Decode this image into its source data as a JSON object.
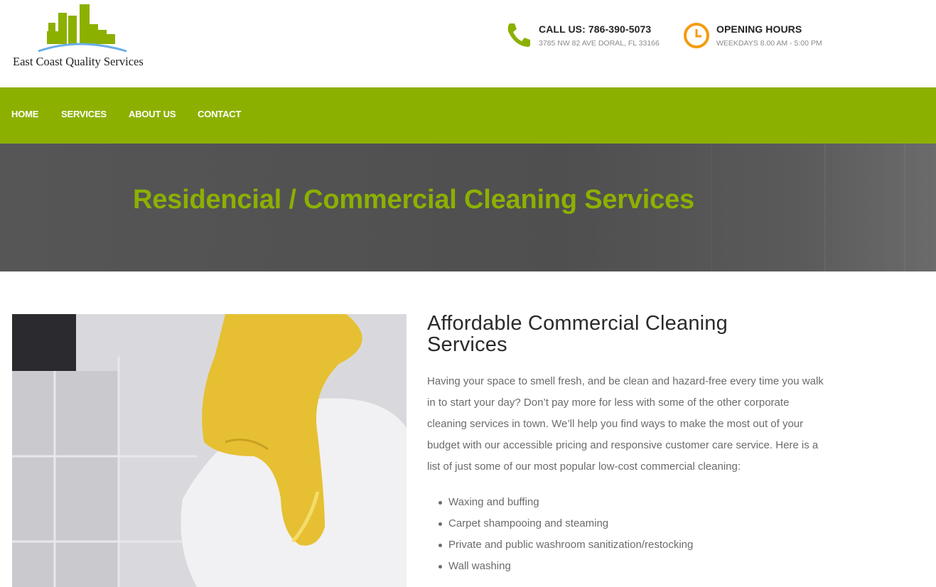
{
  "header": {
    "logo_text": "East Coast Quality Services",
    "call": {
      "title": "CALL US: 786-390-5073",
      "sub": "3785 NW 82 AVE DORAL, FL 33166",
      "icon": "phone-icon"
    },
    "hours": {
      "title": "OPENING HOURS",
      "sub": "WEEKDAYS 8.00 AM - 5:00 PM",
      "icon": "clock-icon"
    }
  },
  "nav": {
    "items": [
      {
        "label": "HOME"
      },
      {
        "label": "SERVICES"
      },
      {
        "label": "ABOUT US"
      },
      {
        "label": "CONTACT"
      }
    ]
  },
  "hero": {
    "title": "Residencial / Commercial Cleaning Services"
  },
  "content": {
    "heading": "Affordable Commercial Cleaning Services",
    "paragraph": "Having your space to smell fresh, and be clean and hazard-free every time you walk in to start your day? Don’t pay more for less with some of the other corporate cleaning services in town. We’ll help you find ways to make the most out of your budget with our accessible pricing and responsive customer care service. Here is a list of just some of our most popular low-cost commercial cleaning:",
    "list": [
      "Waxing and buffing",
      "Carpet shampooing and steaming",
      "Private and public washroom sanitization/restocking",
      "Wall washing"
    ]
  },
  "colors": {
    "brand_green": "#8cb000",
    "accent_orange": "#f39c12",
    "hero_bg": "#525252",
    "text_body": "#6b6b6b"
  }
}
